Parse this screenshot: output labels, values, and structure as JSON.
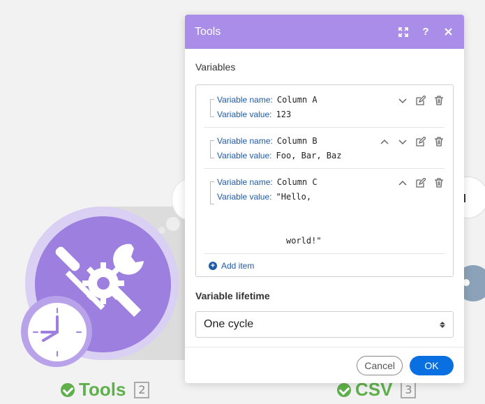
{
  "canvas": {
    "modules": [
      {
        "name": "Tools",
        "number": "2"
      },
      {
        "name": "CSV",
        "number": "3"
      }
    ]
  },
  "dialog": {
    "title": "Tools",
    "header_icons": [
      "expand-icon",
      "help-icon",
      "close-icon"
    ],
    "variables_label": "Variables",
    "variables": [
      {
        "name_label": "Variable name",
        "name": "Column A",
        "value_label": "Variable value",
        "value": "123"
      },
      {
        "name_label": "Variable name",
        "name": "Column B",
        "value_label": "Variable value",
        "value": "Foo, Bar, Baz"
      },
      {
        "name_label": "Variable name",
        "name": "Column C",
        "value_label": "Variable value",
        "value": "\"Hello,\n\n\n  world!\""
      }
    ],
    "add_item": "Add item",
    "lifetime_label": "Variable lifetime",
    "lifetime_value": "One cycle",
    "cancel": "Cancel",
    "ok": "OK"
  },
  "colors": {
    "header": "#a98de9",
    "module_purple": "#9d7fe0",
    "link_blue": "#1e5ba8",
    "ok_blue": "#0a6fe0",
    "success_green": "#5fb04c"
  }
}
